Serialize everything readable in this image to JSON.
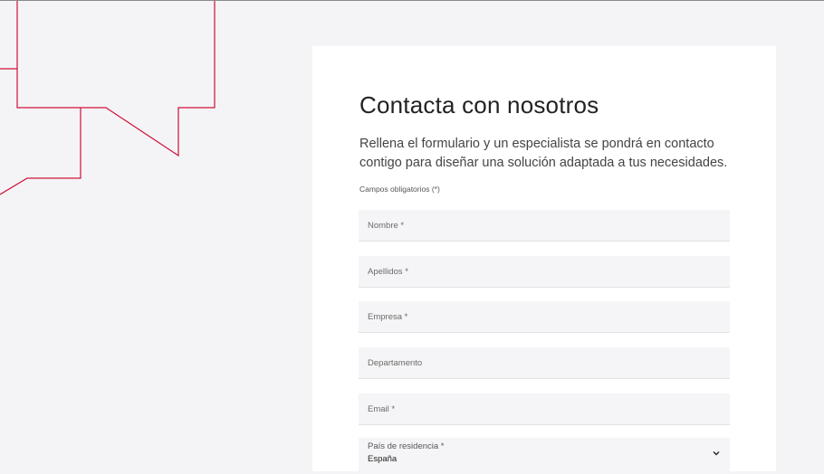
{
  "form": {
    "title": "Contacta con nosotros",
    "intro": "Rellena el formulario y un especialista se pondrá en contacto contigo para diseñar una solución adaptada a tus necesidades.",
    "required_note": "Campos obligatorios (*)",
    "fields": [
      {
        "placeholder": "Nombre *"
      },
      {
        "placeholder": "Apellidos *"
      },
      {
        "placeholder": "Empresa *"
      },
      {
        "placeholder": "Departamento"
      },
      {
        "placeholder": "Email *"
      }
    ],
    "country": {
      "label": "País de residencia *",
      "value": "España"
    }
  },
  "colors": {
    "accent": "#d0103a",
    "background": "#f4f4f6",
    "card": "#ffffff"
  },
  "icons": {
    "select_arrow": "chevron-down-icon",
    "decoration": "speech-bubble-outline"
  }
}
